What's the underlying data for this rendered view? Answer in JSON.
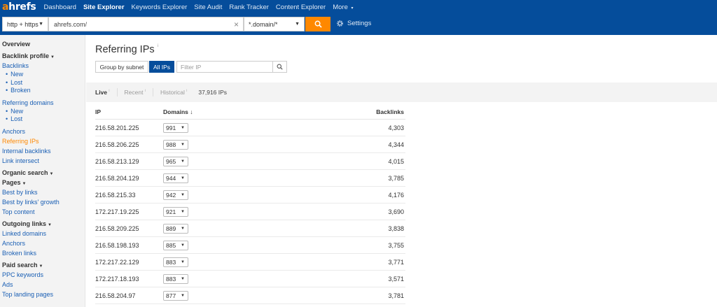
{
  "brand": {
    "logo_a": "a",
    "logo_rest": "hrefs"
  },
  "topnav": {
    "items": [
      {
        "label": "Dashboard"
      },
      {
        "label": "Site Explorer"
      },
      {
        "label": "Keywords Explorer"
      },
      {
        "label": "Site Audit"
      },
      {
        "label": "Rank Tracker"
      },
      {
        "label": "Content Explorer"
      },
      {
        "label": "More"
      }
    ],
    "more_caret": "▾"
  },
  "search": {
    "protocol": "http + https",
    "url": "ahrefs.com/",
    "mode": "*.domain/*",
    "settings_label": "Settings"
  },
  "sidebar": {
    "overview": "Overview",
    "backlink_profile": "Backlink profile",
    "backlinks": "Backlinks",
    "backlinks_sub": [
      "New",
      "Lost",
      "Broken"
    ],
    "referring_domains": "Referring domains",
    "refdomains_sub": [
      "New",
      "Lost"
    ],
    "anchors": "Anchors",
    "referring_ips": "Referring IPs",
    "internal_backlinks": "Internal backlinks",
    "link_intersect": "Link intersect",
    "organic_search": "Organic search",
    "pages": "Pages",
    "best_by_links": "Best by links",
    "best_by_links_growth": "Best by links' growth",
    "top_content": "Top content",
    "outgoing_links": "Outgoing links",
    "linked_domains": "Linked domains",
    "out_anchors": "Anchors",
    "broken_links": "Broken links",
    "paid_search": "Paid search",
    "ppc_keywords": "PPC keywords",
    "ads": "Ads",
    "top_landing_pages": "Top landing pages"
  },
  "main": {
    "title": "Referring IPs",
    "title_info": "i",
    "group_by_subnet": "Group by subnet",
    "all_ips": "All IPs",
    "filter_placeholder": "Filter IP",
    "tabs": {
      "live": "Live",
      "recent": "Recent",
      "historical": "Historical",
      "info": "i"
    },
    "ip_count": "37,916 IPs",
    "columns": {
      "ip": "IP",
      "domains": "Domains",
      "domains_sort": "↓",
      "backlinks": "Backlinks"
    },
    "rows": [
      {
        "ip": "216.58.201.225",
        "domains": "991",
        "backlinks": "4,303"
      },
      {
        "ip": "216.58.206.225",
        "domains": "988",
        "backlinks": "4,344"
      },
      {
        "ip": "216.58.213.129",
        "domains": "965",
        "backlinks": "4,015"
      },
      {
        "ip": "216.58.204.129",
        "domains": "944",
        "backlinks": "3,785"
      },
      {
        "ip": "216.58.215.33",
        "domains": "942",
        "backlinks": "4,176"
      },
      {
        "ip": "172.217.19.225",
        "domains": "921",
        "backlinks": "3,690"
      },
      {
        "ip": "216.58.209.225",
        "domains": "889",
        "backlinks": "3,838"
      },
      {
        "ip": "216.58.198.193",
        "domains": "885",
        "backlinks": "3,755"
      },
      {
        "ip": "172.217.22.129",
        "domains": "883",
        "backlinks": "3,771"
      },
      {
        "ip": "172.217.18.193",
        "domains": "883",
        "backlinks": "3,571"
      },
      {
        "ip": "216.58.204.97",
        "domains": "877",
        "backlinks": "3,781"
      }
    ]
  },
  "colors": {
    "nav_bg": "#054d9b",
    "accent": "#ff8800",
    "link": "#1a5fb4"
  }
}
